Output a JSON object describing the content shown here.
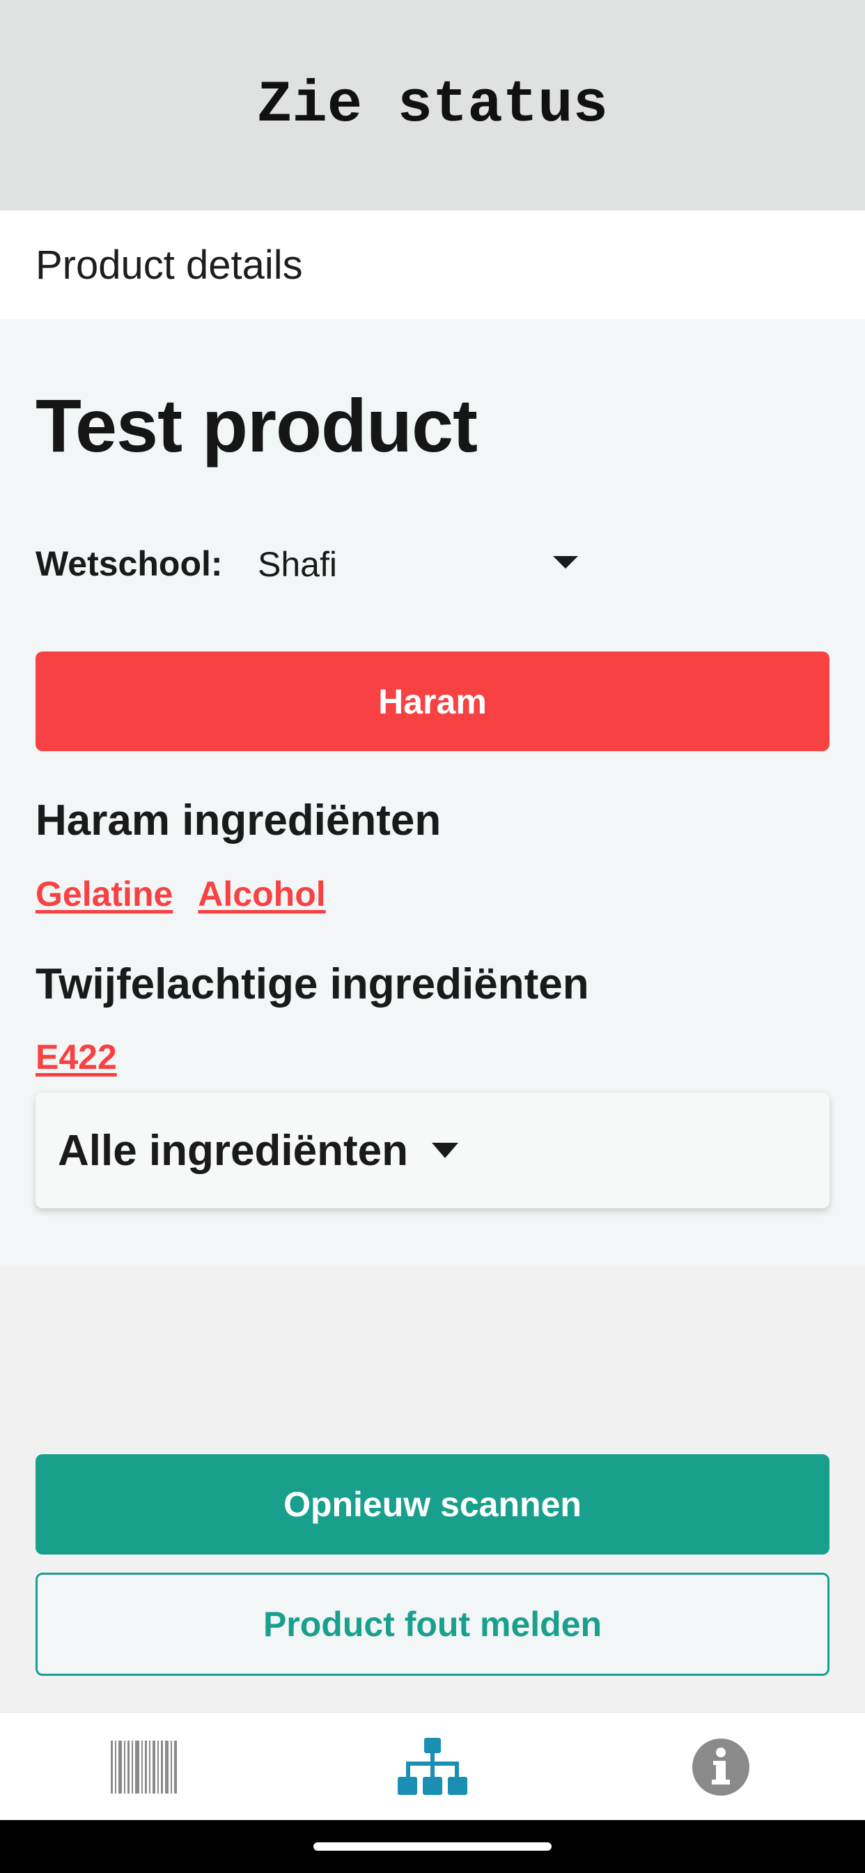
{
  "header": {
    "title": "Zie status"
  },
  "subheader": {
    "label": "Product details"
  },
  "product": {
    "name": "Test product",
    "wetschool": {
      "label": "Wetschool:",
      "selected": "Shafi"
    },
    "status": {
      "label": "Haram",
      "color": "#f84142"
    },
    "haram_section": {
      "heading": "Haram ingrediënten",
      "items": [
        "Gelatine",
        "Alcohol"
      ]
    },
    "doubtful_section": {
      "heading": "Twijfelachtige ingrediënten",
      "items": [
        "E422"
      ]
    },
    "all_ingredients": {
      "label": "Alle ingrediënten"
    }
  },
  "actions": {
    "rescan_label": "Opnieuw scannen",
    "report_label": "Product fout melden"
  },
  "bottom_nav": {
    "items": [
      {
        "icon": "barcode-icon",
        "active": false
      },
      {
        "icon": "sitemap-icon",
        "active": true
      },
      {
        "icon": "info-icon",
        "active": false
      }
    ]
  },
  "colors": {
    "accent": "#19a08c",
    "danger": "#f84142",
    "active_nav": "#1a8fb3",
    "inactive_nav": "#8a8a8a"
  }
}
